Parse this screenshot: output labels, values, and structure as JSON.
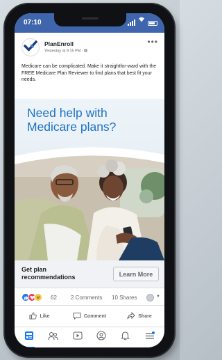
{
  "status_bar": {
    "time": "07:10"
  },
  "post": {
    "page_name": "PlanEnroll",
    "meta": "Yesterday at 9:15 PM · ",
    "more_label": "•••",
    "text": "Medicare can be complicated. Make it straightfor-ward with the FREE Medicare Plan Reviewer to find plans that best fit your needs."
  },
  "ad": {
    "headline": "Need help with Medicare plans?",
    "cta_text": "Get plan recommendations",
    "cta_button": "Learn More"
  },
  "engagement": {
    "reaction_count": "62",
    "comments": "2 Comments",
    "shares": "10 Shares"
  },
  "actions": {
    "like": "Like",
    "comment": "Comment",
    "share": "Share"
  },
  "colors": {
    "brand_blue": "#1877f2",
    "status_bar": "#3f66ad",
    "headline": "#1f73c7"
  },
  "icons": {
    "logo": "checkmark-logo-icon",
    "reactions": [
      "like-reaction-icon",
      "love-reaction-icon",
      "haha-reaction-icon"
    ],
    "nav": [
      "news-feed-icon",
      "groups-icon",
      "watch-icon",
      "profile-icon",
      "notifications-icon",
      "menu-icon"
    ]
  }
}
